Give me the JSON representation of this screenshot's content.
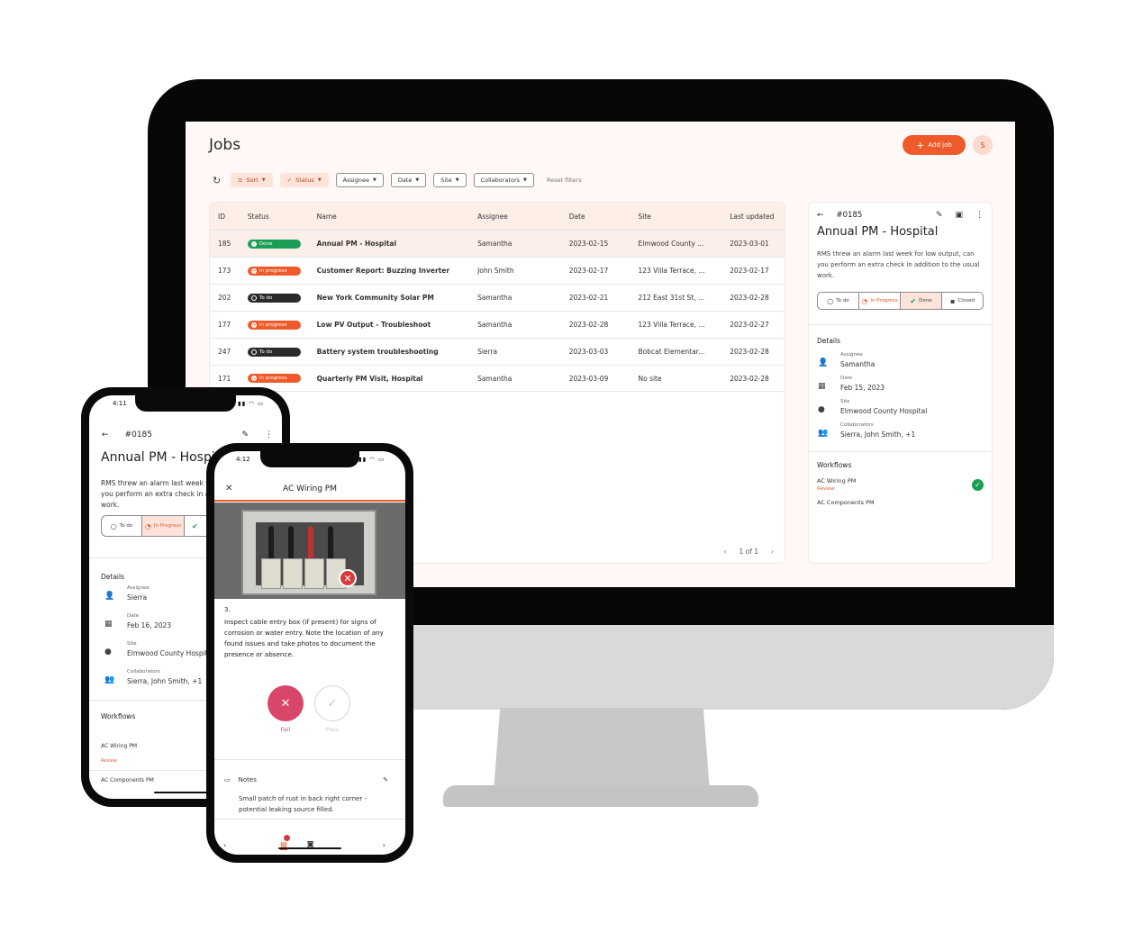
{
  "desktop": {
    "page_title": "Jobs",
    "add_job_label": "Add job",
    "avatar_initial": "S",
    "filters": {
      "sort": "Sort",
      "status": "Status",
      "assignee": "Assignee",
      "date": "Date",
      "site": "Site",
      "collaborators": "Collaborators",
      "reset": "Reset filters"
    },
    "table": {
      "headers": [
        "ID",
        "Status",
        "Name",
        "Assignee",
        "Date",
        "Site",
        "Last updated"
      ],
      "rows": [
        {
          "id": "185",
          "status": "Done",
          "name": "Annual PM - Hospital",
          "assignee": "Samantha",
          "date": "2023-02-15",
          "site": "Elmwood County ...",
          "updated": "2023-03-01"
        },
        {
          "id": "173",
          "status": "In progress",
          "name": "Customer Report: Buzzing Inverter",
          "assignee": "John Smith",
          "date": "2023-02-17",
          "site": "123 Villa Terrace, ...",
          "updated": "2023-02-17"
        },
        {
          "id": "202",
          "status": "To do",
          "name": "New York Community Solar PM",
          "assignee": "Samantha",
          "date": "2023-02-21",
          "site": "212 East 31st St, ...",
          "updated": "2023-02-28"
        },
        {
          "id": "177",
          "status": "In progress",
          "name": "Low PV Output - Troubleshoot",
          "assignee": "Samantha",
          "date": "2023-02-28",
          "site": "123 Villa Terrace, ...",
          "updated": "2023-02-27"
        },
        {
          "id": "247",
          "status": "To do",
          "name": "Battery system troubleshooting",
          "assignee": "Sierra",
          "date": "2023-03-03",
          "site": "Bobcat Elementar...",
          "updated": "2023-02-28"
        },
        {
          "id": "171",
          "status": "In progress",
          "name": "Quarterly PM Visit, Hospital",
          "assignee": "Samantha",
          "date": "2023-03-09",
          "site": "No site",
          "updated": "2023-02-28"
        }
      ],
      "pagination": "1 of 1"
    },
    "detail": {
      "job_id": "#0185",
      "title": "Annual PM - Hospital",
      "description": "RMS threw an alarm last week for low output, can you perform an extra check in addition to the usual work.",
      "status_options": [
        "To do",
        "In Progress",
        "Done",
        "Closed"
      ],
      "details_heading": "Details",
      "assignee_label": "Assignee",
      "assignee": "Samantha",
      "date_label": "Date",
      "date": "Feb 15, 2023",
      "site_label": "Site",
      "site": "Elmwood County Hospital",
      "collaborators_label": "Collaborators",
      "collaborators": "Sierra, John Smith, +1",
      "workflows_heading": "Workflows",
      "workflow_name": "AC Wiring PM",
      "workflow_status": "Review",
      "workflow_partial": "AC Components PM"
    }
  },
  "phone1": {
    "time": "4:11",
    "job_id": "#0185",
    "title": "Annual PM - Hospital",
    "description": "RMS threw an alarm last week for low output, can you perform an extra check in addition to the usual work.",
    "status_options": [
      "To do",
      "In Progress"
    ],
    "details_heading": "Details",
    "assignee_label": "Assignee",
    "assignee": "Sierra",
    "date_label": "Date",
    "date": "Feb 16, 2023",
    "site_label": "Site",
    "site": "Elmwood County Hospital",
    "collaborators_label": "Collaborators",
    "collaborators": "Sierra, John Smith, +1",
    "workflows_heading": "Workflows",
    "workflow1": "AC Wiring PM",
    "workflow1_status": "Review",
    "workflow2": "AC Components PM"
  },
  "phone2": {
    "time": "4:12",
    "title": "AC Wiring PM",
    "step_number": "3.",
    "instruction": "Inspect cable entry box (if present) for signs of corrosion or water entry. Note the location of any found issues and take photos to document the presence or absence.",
    "fail_label": "Fail",
    "pass_label": "Pass",
    "notes_label": "Notes",
    "notes_text": "Small patch of rust in back right corner - potential leaking source filled."
  },
  "colors": {
    "accent": "#ef5a2a",
    "done": "#1a9e55",
    "todo": "#2b2b2b",
    "fail": "#d8466a"
  }
}
